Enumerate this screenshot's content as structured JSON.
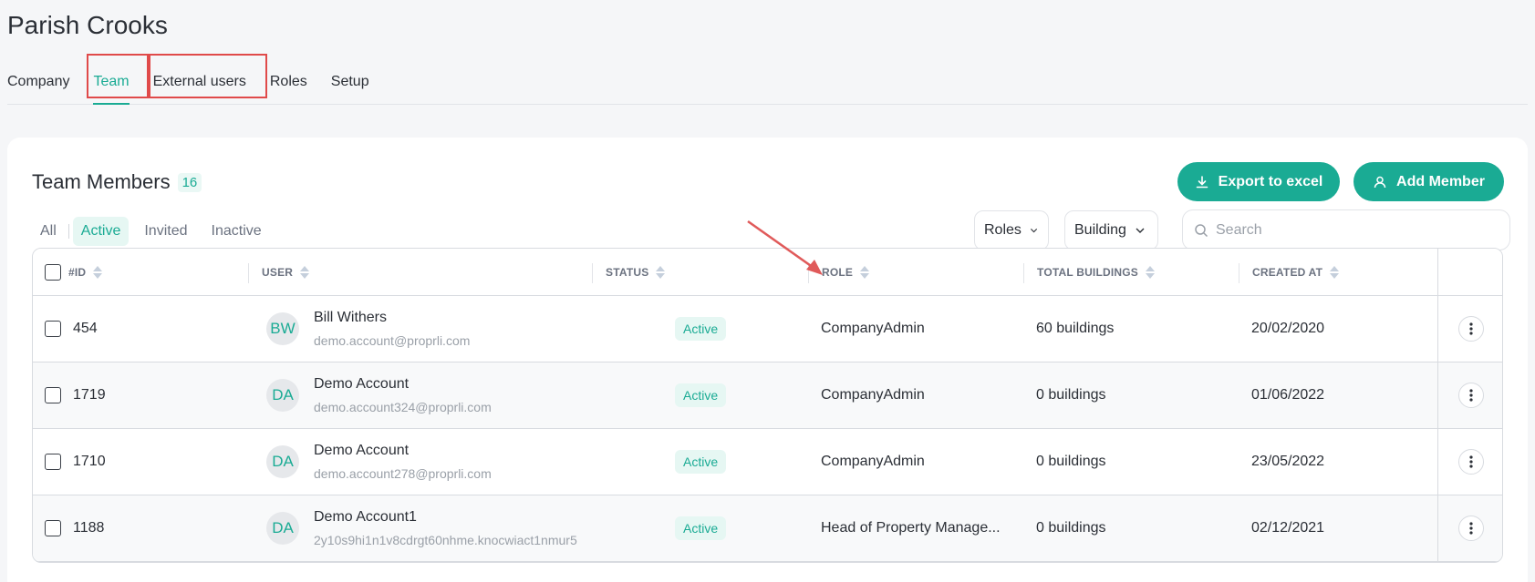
{
  "page": {
    "title": "Parish Crooks"
  },
  "tabs": [
    {
      "label": "Company"
    },
    {
      "label": "Team"
    },
    {
      "label": "External users"
    },
    {
      "label": "Roles"
    },
    {
      "label": "Setup"
    }
  ],
  "section": {
    "title": "Team Members",
    "count": "16"
  },
  "buttons": {
    "export": "Export to excel",
    "add_member": "Add Member"
  },
  "filters": {
    "all": "All",
    "active": "Active",
    "invited": "Invited",
    "inactive": "Inactive"
  },
  "dropdowns": {
    "roles": "Roles",
    "building": "Building"
  },
  "search": {
    "placeholder": "Search"
  },
  "table": {
    "headers": {
      "id": "#ID",
      "user": "USER",
      "status": "STATUS",
      "role": "ROLE",
      "total_buildings": "TOTAL BUILDINGS",
      "created_at": "CREATED AT"
    },
    "rows": [
      {
        "id": "454",
        "initials": "BW",
        "name": "Bill Withers",
        "email": "demo.account@proprli.com",
        "status": "Active",
        "role": "CompanyAdmin",
        "buildings": "60 buildings",
        "created": "20/02/2020"
      },
      {
        "id": "1719",
        "initials": "DA",
        "name": "Demo Account",
        "email": "demo.account324@proprli.com",
        "status": "Active",
        "role": "CompanyAdmin",
        "buildings": "0 buildings",
        "created": "01/06/2022"
      },
      {
        "id": "1710",
        "initials": "DA",
        "name": "Demo Account",
        "email": "demo.account278@proprli.com",
        "status": "Active",
        "role": "CompanyAdmin",
        "buildings": "0 buildings",
        "created": "23/05/2022"
      },
      {
        "id": "1188",
        "initials": "DA",
        "name": "Demo Account1",
        "email": "2y10s9hi1n1v8cdrgt60nhme.knocwiact1nmur5",
        "status": "Active",
        "role": "Head of Property Manage...",
        "buildings": "0 buildings",
        "created": "02/12/2021"
      }
    ]
  },
  "colors": {
    "accent": "#1aab94",
    "highlight": "#e04a4a"
  }
}
